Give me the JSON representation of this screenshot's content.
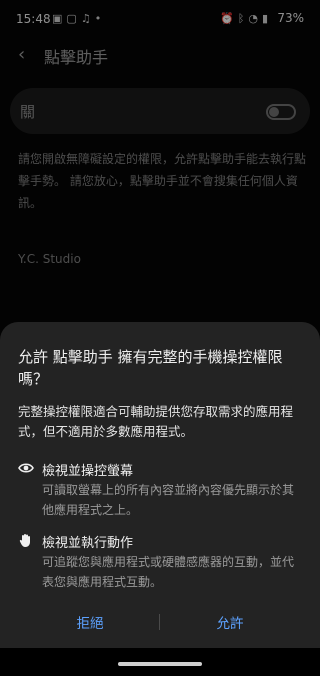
{
  "statusbar": {
    "time": "15:48",
    "battery": "73%",
    "left_icons": [
      "gallery-icon",
      "message-icon",
      "audio-icon",
      "dot-icon"
    ],
    "right_icons": [
      "alarm-icon",
      "bluetooth-icon",
      "wifi-icon",
      "signal-icon"
    ]
  },
  "header": {
    "title": "點擊助手"
  },
  "toggle_row": {
    "label": "關",
    "state": "off"
  },
  "description": "請您開啟無障礙設定的權限，允許點擊助手能去執行點擊手勢。 請您放心，點擊助手並不會搜集任何個人資訊。",
  "studio": "Y.C. Studio",
  "dialog": {
    "title": "允許 點擊助手 擁有完整的手機操控權限嗎？",
    "body": "完整操控權限適合可輔助提供您存取需求的應用程式，但不適用於多數應用程式。",
    "permissions": [
      {
        "heading": "檢視並操控螢幕",
        "text": "可讀取螢幕上的所有內容並將內容優先顯示於其他應用程式之上。",
        "icon": "eye-icon"
      },
      {
        "heading": "檢視並執行動作",
        "text": "可追蹤您與應用程式或硬體感應器的互動，並代表您與應用程式互動。",
        "icon": "hand-icon"
      }
    ],
    "deny_label": "拒絕",
    "allow_label": "允許"
  },
  "colors": {
    "accent": "#5da2ff",
    "sheet_bg": "#232323",
    "bg": "#050505"
  }
}
